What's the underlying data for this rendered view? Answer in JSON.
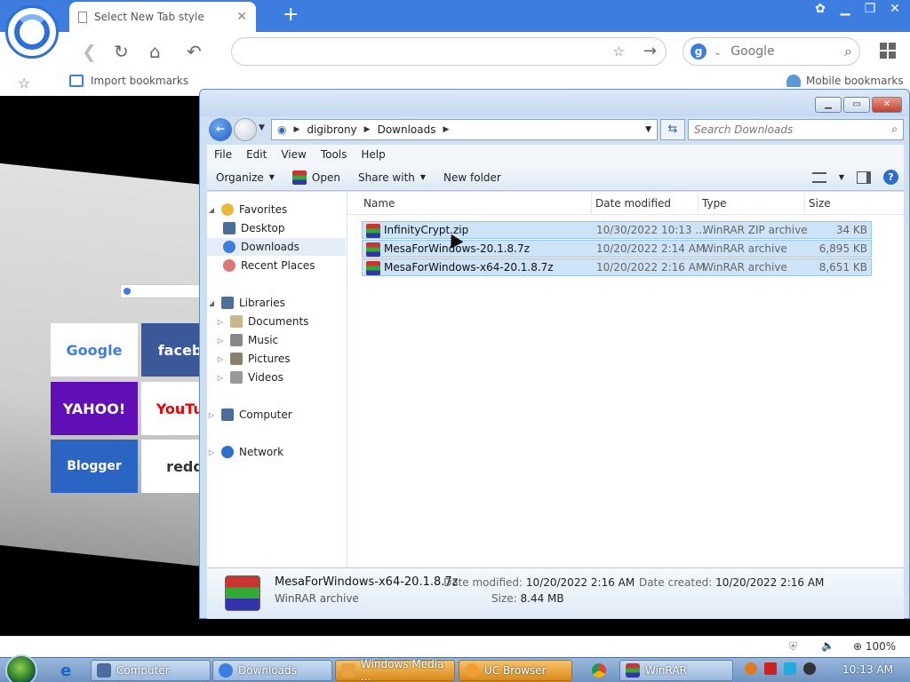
{
  "browser": {
    "tab_title": "Select New Tab style",
    "search_engine_badge": "g",
    "search_placeholder": "Google",
    "bookmarks": {
      "import_label": "Import bookmarks",
      "mobile_label": "Mobile bookmarks"
    },
    "tiles": [
      "Google",
      "facebo",
      "YAHOO!",
      "YouTub",
      "Blogger",
      "redd"
    ],
    "status": {
      "zoom": "100%"
    }
  },
  "explorer": {
    "breadcrumb": [
      "digibrony",
      "Downloads"
    ],
    "search_placeholder": "Search Downloads",
    "menu": [
      "File",
      "Edit",
      "View",
      "Tools",
      "Help"
    ],
    "commands": {
      "organize": "Organize",
      "open": "Open",
      "share": "Share with",
      "new_folder": "New folder"
    },
    "nav": {
      "favorites": "Favorites",
      "desktop": "Desktop",
      "downloads": "Downloads",
      "recent": "Recent Places",
      "libraries": "Libraries",
      "documents": "Documents",
      "music": "Music",
      "pictures": "Pictures",
      "videos": "Videos",
      "computer": "Computer",
      "network": "Network"
    },
    "columns": {
      "name": "Name",
      "date": "Date modified",
      "type": "Type",
      "size": "Size"
    },
    "files": [
      {
        "name": "InfinityCrypt.zip",
        "date": "10/30/2022 10:13 ...",
        "type": "WinRAR ZIP archive",
        "size": "34 KB"
      },
      {
        "name": "MesaForWindows-20.1.8.7z",
        "date": "10/20/2022 2:14 AM",
        "type": "WinRAR archive",
        "size": "6,895 KB"
      },
      {
        "name": "MesaForWindows-x64-20.1.8.7z",
        "date": "10/20/2022 2:16 AM",
        "type": "WinRAR archive",
        "size": "8,651 KB"
      }
    ],
    "details": {
      "name": "MesaForWindows-x64-20.1.8.7z",
      "type": "WinRAR archive",
      "modified_label": "Date modified:",
      "modified_value": "10/20/2022 2:16 AM",
      "size_label": "Size:",
      "size_value": "8.44 MB",
      "created_label": "Date created:",
      "created_value": "10/20/2022 2:16 AM"
    }
  },
  "taskbar": {
    "buttons": [
      "Computer",
      "Downloads",
      "Windows Media ...",
      "UC Browser",
      "WinRAR"
    ],
    "clock": "10:13 AM"
  }
}
